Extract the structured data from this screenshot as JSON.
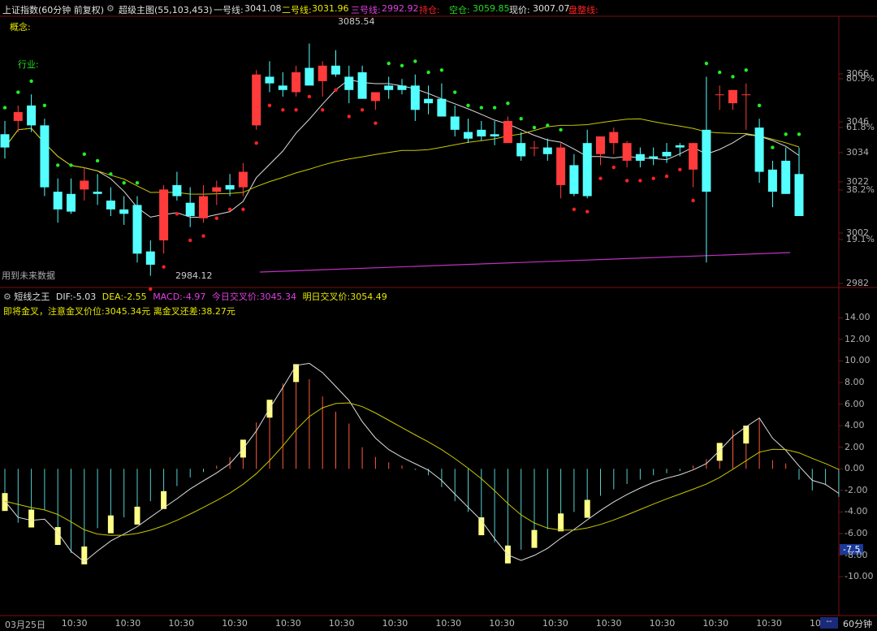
{
  "header": {
    "index_name": "上证指数(60分钟 前复权)",
    "indicator": "超级主图(55,103,453)",
    "line1_label": "一号线:",
    "line1_value": "3041.08",
    "line2_label": "二号线:",
    "line2_value": "3031.96",
    "line3_label": "三号线:",
    "line3_value": "2992.92",
    "hold_label": "持仓:",
    "short_label": "空仓:",
    "short_value": "3059.85",
    "price_label": "现价:",
    "price_value": "3007.07",
    "consolidation_label": "盘整线:",
    "colors": {
      "line1": "#dddddd",
      "line2": "#e8e800",
      "line3": "#e040e0",
      "hold": "#ff2222",
      "short": "#22dd22"
    }
  },
  "main_panel": {
    "concept_label": "概念:",
    "industry_label": "行业:",
    "future_data_label": "用到未来数据",
    "high_annotation": "3085.54",
    "low_annotation": "2984.12",
    "right_axis": [
      {
        "label": "3066",
        "color": "#b0b0b0"
      },
      {
        "label": "80.9%",
        "color": "#b0b0b0"
      },
      {
        "label": "3046",
        "color": "#b0b0b0"
      },
      {
        "label": "61.8%",
        "color": "#b0b0b0"
      },
      {
        "label": "3034",
        "color": "#b0b0b0"
      },
      {
        "label": "3022",
        "color": "#b0b0b0"
      },
      {
        "label": "38.2%",
        "color": "#b0b0b0"
      },
      {
        "label": "3002",
        "color": "#b0b0b0"
      },
      {
        "label": "19.1%",
        "color": "#b0b0b0"
      },
      {
        "label": "2982",
        "color": "#b0b0b0"
      }
    ]
  },
  "macd_panel": {
    "title": "短线之王",
    "dif_label": "DIF:",
    "dif_value": "-5.03",
    "dea_label": "DEA:",
    "dea_value": "-2.55",
    "macd_label": "MACD:",
    "macd_value": "-4.97",
    "today_cross_label": "今日交叉价:",
    "today_cross_value": "3045.34",
    "tomorrow_cross_label": "明日交叉价:",
    "tomorrow_cross_value": "3054.49",
    "note": "即将金叉，注意金叉价位:3045.34元 离金叉还差:38.27元",
    "right_axis": [
      "14.00",
      "12.00",
      "10.00",
      "8.00",
      "6.00",
      "4.00",
      "2.00",
      "0.00",
      "-2.00",
      "-4.00",
      "-6.00",
      "-7.5",
      "-8.00",
      "-10.00"
    ]
  },
  "x_axis": {
    "labels": [
      "03月25日",
      "10:30",
      "10:30",
      "10:30",
      "10:30",
      "10:30",
      "10:30",
      "10:30",
      "10:30",
      "10:30",
      "10:30",
      "10:30",
      "10:30",
      "10:30",
      "10:30",
      "10:30"
    ],
    "period": "60分钟",
    "scroll_label": "--"
  },
  "chart_data": {
    "type": "candlestick",
    "y_range": [
      2978,
      3090
    ],
    "candles": [
      [
        3044,
        3050,
        3033,
        3038
      ],
      [
        3050,
        3057,
        3045,
        3054
      ],
      [
        3057,
        3062,
        3045,
        3048
      ],
      [
        3048,
        3051,
        3016,
        3020
      ],
      [
        3018,
        3024,
        3004,
        3010
      ],
      [
        3017,
        3024,
        3008,
        3009
      ],
      [
        3019,
        3029,
        3014,
        3023
      ],
      [
        3018,
        3026,
        3012,
        3017
      ],
      [
        3014,
        3020,
        3007,
        3010
      ],
      [
        3010,
        3016,
        3003,
        3008
      ],
      [
        3012,
        3016,
        2986,
        2990
      ],
      [
        2991,
        2996,
        2980,
        2985
      ],
      [
        2996,
        3021,
        2990,
        3019
      ],
      [
        3021,
        3027,
        3014,
        3016
      ],
      [
        3013,
        3020,
        3002,
        3007
      ],
      [
        3006,
        3021,
        3004,
        3016
      ],
      [
        3018,
        3023,
        3012,
        3020
      ],
      [
        3021,
        3026,
        3016,
        3019
      ],
      [
        3020,
        3031,
        3016,
        3027
      ],
      [
        3048,
        3073,
        3046,
        3071
      ],
      [
        3070,
        3077,
        3063,
        3067
      ],
      [
        3066,
        3072,
        3061,
        3064
      ],
      [
        3063,
        3075,
        3061,
        3072
      ],
      [
        3074,
        3085,
        3067,
        3066
      ],
      [
        3068,
        3077,
        3061,
        3075
      ],
      [
        3075,
        3082,
        3070,
        3071
      ],
      [
        3070,
        3075,
        3058,
        3064
      ],
      [
        3072,
        3075,
        3061,
        3060
      ],
      [
        3059,
        3063,
        3055,
        3063
      ],
      [
        3066,
        3070,
        3060,
        3064
      ],
      [
        3066,
        3069,
        3062,
        3064
      ],
      [
        3066,
        3071,
        3050,
        3055
      ],
      [
        3060,
        3066,
        3053,
        3058
      ],
      [
        3060,
        3067,
        3052,
        3052
      ],
      [
        3052,
        3057,
        3043,
        3046
      ],
      [
        3045,
        3051,
        3040,
        3042
      ],
      [
        3046,
        3050,
        3041,
        3043
      ],
      [
        3044,
        3050,
        3039,
        3043
      ],
      [
        3040,
        3052,
        3040,
        3050
      ],
      [
        3040,
        3045,
        3032,
        3034
      ],
      [
        3038,
        3041,
        3034,
        3038
      ],
      [
        3038,
        3042,
        3032,
        3035
      ],
      [
        3021,
        3040,
        3015,
        3038
      ],
      [
        3030,
        3035,
        3016,
        3017
      ],
      [
        3040,
        3046,
        3015,
        3016
      ],
      [
        3035,
        3043,
        3030,
        3043
      ],
      [
        3040,
        3047,
        3035,
        3045
      ],
      [
        3032,
        3041,
        3029,
        3040
      ],
      [
        3035,
        3038,
        3029,
        3032
      ],
      [
        3034,
        3038,
        3030,
        3033
      ],
      [
        3036,
        3040,
        3031,
        3034
      ],
      [
        3039,
        3040,
        3034,
        3038
      ],
      [
        3028,
        3040,
        3020,
        3040
      ],
      [
        3046,
        3070,
        2986,
        3018
      ],
      [
        3062,
        3066,
        3055,
        3062
      ],
      [
        3058,
        3064,
        3055,
        3064
      ],
      [
        3062,
        3067,
        3046,
        3062
      ],
      [
        3047,
        3051,
        3022,
        3027
      ],
      [
        3028,
        3032,
        3011,
        3018
      ],
      [
        3032,
        3038,
        3017,
        3017
      ],
      [
        3026,
        3038,
        3008,
        3007
      ]
    ],
    "macd_histogram": [
      -2.5,
      -5.0,
      -4.2,
      -3.8,
      -6.0,
      -7.8,
      -8.0,
      -5.5,
      -4.8,
      -4.5,
      -3.9,
      -3.0,
      -2.3,
      -1.6,
      -0.8,
      -0.3,
      0.3,
      1.1,
      2.7,
      4.3,
      6.4,
      7.9,
      9.7,
      8.3,
      6.7,
      5.3,
      4.2,
      2.0,
      1.1,
      0.6,
      0.3,
      -0.1,
      -0.6,
      -1.7,
      -3.0,
      -4.0,
      -5.0,
      -6.8,
      -7.9,
      -7.5,
      -6.3,
      -5.6,
      -4.6,
      -4.0,
      -3.2,
      -2.5,
      -1.9,
      -1.4,
      -1.0,
      -0.6,
      -0.4,
      -0.2,
      0.3,
      0.9,
      2.4,
      3.6,
      4.0,
      4.6,
      0.8,
      0.5,
      -1.0,
      -2.0,
      -1.5,
      -2.6
    ],
    "y_range_macd": [
      -13,
      15
    ]
  }
}
